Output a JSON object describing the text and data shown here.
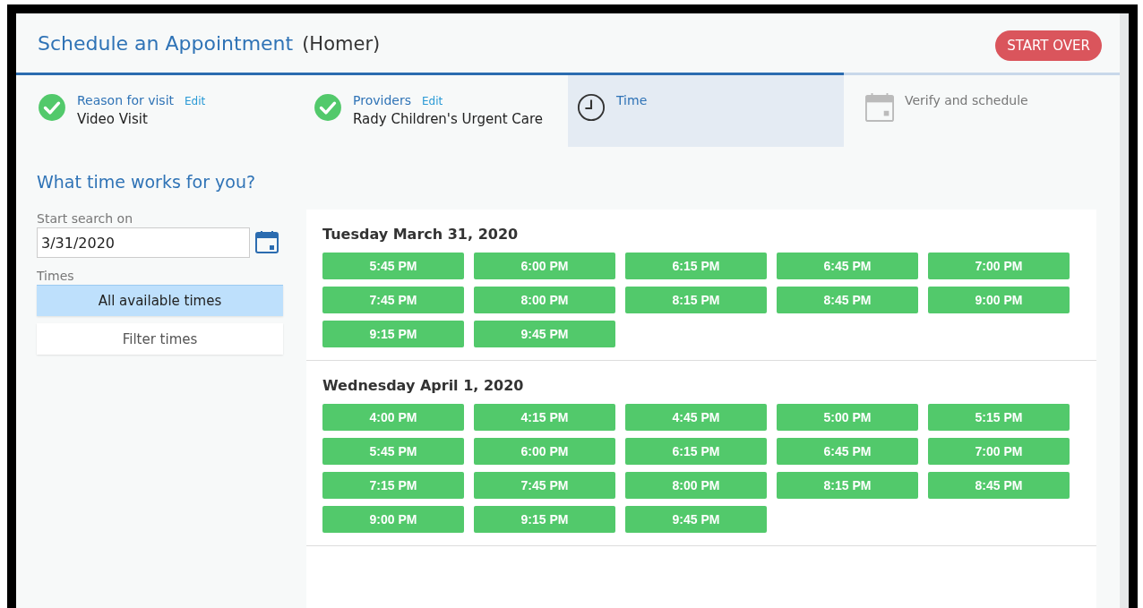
{
  "header": {
    "title": "Schedule an Appointment",
    "patient": "(Homer)",
    "start_over": "START OVER"
  },
  "steps": [
    {
      "label": "Reason for visit",
      "edit": "Edit",
      "value": "Video Visit",
      "kind": "complete"
    },
    {
      "label": "Providers",
      "edit": "Edit",
      "value": "Rady Children's Urgent Care",
      "kind": "complete"
    },
    {
      "label": "Time",
      "kind": "current"
    },
    {
      "label": "Verify and schedule",
      "kind": "pending"
    }
  ],
  "question": "What time works for you?",
  "search": {
    "label": "Start search on",
    "value": "3/31/2020"
  },
  "times_filter": {
    "label": "Times",
    "options": [
      {
        "label": "All available times",
        "selected": true
      },
      {
        "label": "Filter times",
        "selected": false
      }
    ]
  },
  "days": [
    {
      "date": "Tuesday March 31, 2020",
      "slots": [
        "5:45 PM",
        "6:00 PM",
        "6:15 PM",
        "6:45 PM",
        "7:00 PM",
        "7:45 PM",
        "8:00 PM",
        "8:15 PM",
        "8:45 PM",
        "9:00 PM",
        "9:15 PM",
        "9:45 PM"
      ]
    },
    {
      "date": "Wednesday April 1, 2020",
      "slots": [
        "4:00 PM",
        "4:15 PM",
        "4:45 PM",
        "5:00 PM",
        "5:15 PM",
        "5:45 PM",
        "6:00 PM",
        "6:15 PM",
        "6:45 PM",
        "7:00 PM",
        "7:15 PM",
        "7:45 PM",
        "8:00 PM",
        "8:15 PM",
        "8:45 PM",
        "9:00 PM",
        "9:15 PM",
        "9:45 PM"
      ]
    }
  ]
}
